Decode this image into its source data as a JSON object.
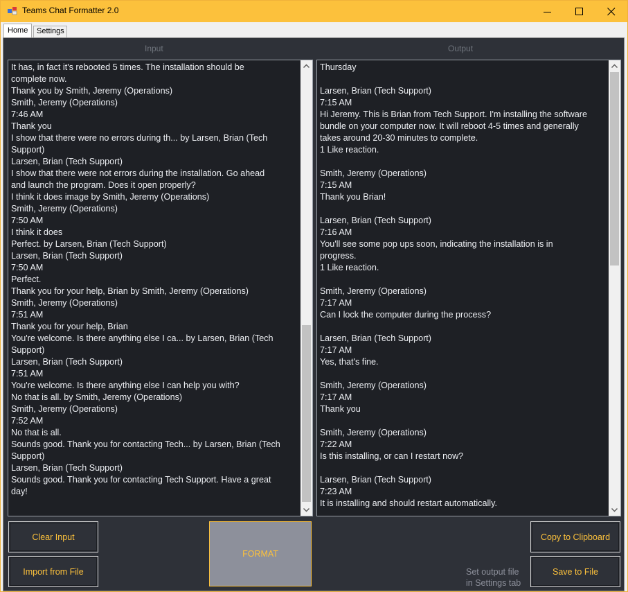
{
  "window": {
    "title": "Teams Chat Formatter 2.0",
    "accent": "#fcc13c",
    "panel_bg": "#2e3138",
    "text_bg": "#1e2025"
  },
  "tabs": [
    {
      "label": "Home",
      "active": true
    },
    {
      "label": "Settings",
      "active": false
    }
  ],
  "input": {
    "label": "Input",
    "text": "It has, in fact it's rebooted 5 times. The installation should be\ncomplete now.\nThank you by Smith, Jeremy (Operations)\nSmith, Jeremy (Operations)\n7:46 AM\nThank you\nI show that there were no errors during th... by Larsen, Brian (Tech\nSupport)\nLarsen, Brian (Tech Support)\nI show that there were not errors during the installation. Go ahead\nand launch the program. Does it open properly?\nI think it does image by Smith, Jeremy (Operations)\nSmith, Jeremy (Operations)\n7:50 AM\nI think it does\nPerfect. by Larsen, Brian (Tech Support)\nLarsen, Brian (Tech Support)\n7:50 AM\nPerfect.\nThank you for your help, Brian by Smith, Jeremy (Operations)\nSmith, Jeremy (Operations)\n7:51 AM\nThank you for your help, Brian\nYou're welcome. Is there anything else I ca... by Larsen, Brian (Tech\nSupport)\nLarsen, Brian (Tech Support)\n7:51 AM\nYou're welcome. Is there anything else I can help you with?\nNo that is all. by Smith, Jeremy (Operations)\nSmith, Jeremy (Operations)\n7:52 AM\nNo that is all.\nSounds good. Thank you for contacting Tech... by Larsen, Brian (Tech\nSupport)\nLarsen, Brian (Tech Support)\nSounds good. Thank you for contacting Tech Support. Have a great\nday!",
    "scroll_position": 0.62
  },
  "output": {
    "label": "Output",
    "text": "Thursday\n\nLarsen, Brian (Tech Support)\n7:15 AM\nHi Jeremy. This is Brian from Tech Support. I'm installing the software\nbundle on your computer now. It will reboot 4-5 times and generally\ntakes around 20-30 minutes to complete.\n1 Like reaction.\n\nSmith, Jeremy (Operations)\n7:15 AM\nThank you Brian!\n\nLarsen, Brian (Tech Support)\n7:16 AM\nYou'll see some pop ups soon, indicating the installation is in\nprogress.\n1 Like reaction.\n\nSmith, Jeremy (Operations)\n7:17 AM\nCan I lock the computer during the process?\n\nLarsen, Brian (Tech Support)\n7:17 AM\nYes, that's fine.\n\nSmith, Jeremy (Operations)\n7:17 AM\nThank you\n\nSmith, Jeremy (Operations)\n7:22 AM\nIs this installing, or can I restart now?\n\nLarsen, Brian (Tech Support)\n7:23 AM\nIt is installing and should restart automatically.",
    "scroll_position": 0.0
  },
  "buttons": {
    "clear_input": "Clear Input",
    "import_from_file": "Import from File",
    "format": "FORMAT",
    "copy_to_clipboard": "Copy to Clipboard",
    "save_to_file": "Save to File"
  },
  "hint": "Set output file\nin Settings tab",
  "icons": [
    "app-icon",
    "minimize-icon",
    "maximize-icon",
    "close-icon",
    "scroll-up-arrow-icon",
    "scroll-down-arrow-icon"
  ]
}
